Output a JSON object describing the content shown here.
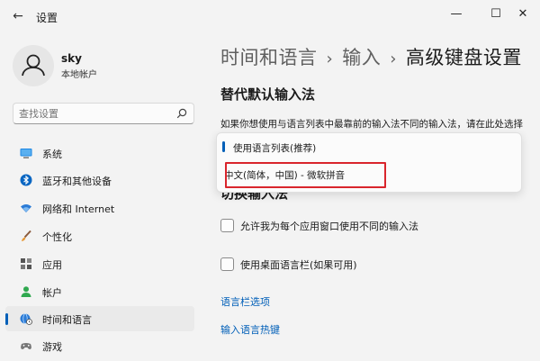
{
  "window": {
    "title": "设置",
    "back_glyph": "←",
    "minimize_glyph": "—",
    "maximize_glyph": "☐",
    "close_glyph": "✕"
  },
  "user": {
    "name": "sky",
    "account_type": "本地帐户",
    "avatar_icon": "user-icon"
  },
  "search": {
    "placeholder": "查找设置",
    "icon": "search-icon"
  },
  "sidebar": {
    "items": [
      {
        "label": "系统",
        "icon": "monitor-icon",
        "active": false
      },
      {
        "label": "蓝牙和其他设备",
        "icon": "bluetooth-icon",
        "active": false
      },
      {
        "label": "网络和 Internet",
        "icon": "wifi-icon",
        "active": false
      },
      {
        "label": "个性化",
        "icon": "brush-icon",
        "active": false
      },
      {
        "label": "应用",
        "icon": "apps-icon",
        "active": false
      },
      {
        "label": "帐户",
        "icon": "person-icon",
        "active": false
      },
      {
        "label": "时间和语言",
        "icon": "globe-clock-icon",
        "active": true
      },
      {
        "label": "游戏",
        "icon": "gamepad-icon",
        "active": false
      }
    ]
  },
  "breadcrumb": {
    "part1": "时间和语言",
    "sep": "›",
    "part2": "输入",
    "part3": "高级键盘设置"
  },
  "main": {
    "section1_title": "替代默认输入法",
    "section1_desc": "如果你想使用与语言列表中最靠前的输入法不同的输入法，请在此处选择",
    "dropdown_options": [
      {
        "label": "使用语言列表(推荐)",
        "selected": true
      },
      {
        "label": "中文(简体，中国) - 微软拼音",
        "selected": false
      }
    ],
    "section2_title": "切换输入法",
    "checkbox1_label": "允许我为每个应用窗口使用不同的输入法",
    "checkbox1_checked": false,
    "checkbox2_label": "使用桌面语言栏(如果可用)",
    "checkbox2_checked": false,
    "link1": "语言栏选项",
    "link2": "输入语言热键"
  },
  "colors": {
    "accent": "#005fb8",
    "highlight": "#d9252c",
    "background": "#f3f3f3"
  }
}
